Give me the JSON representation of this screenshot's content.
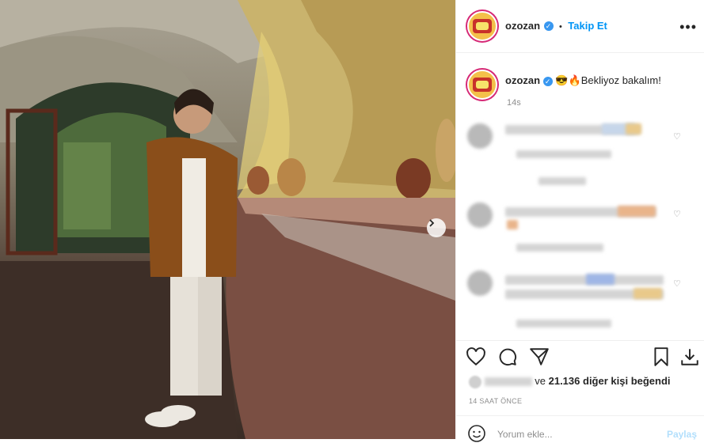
{
  "header": {
    "username": "ozozan",
    "separator": "•",
    "follow_label": "Takip Et",
    "more_label": "•••"
  },
  "caption": {
    "username": "ozozan",
    "emojis": "😎🔥",
    "text": "Bekliyoz bakalım!",
    "time": "14s"
  },
  "likes": {
    "suffix": "ve",
    "count": "21.136",
    "rest": "diğer kişi beğendi"
  },
  "timestamp": "14 SAAT ÖNCE",
  "add_comment": {
    "placeholder": "Yorum ekle...",
    "post_label": "Paylaş"
  },
  "icons": {
    "next": "chevron-right-icon",
    "like": "heart-icon",
    "comment": "comment-icon",
    "share": "send-icon",
    "save": "bookmark-icon",
    "download": "download-icon",
    "emoji": "smiley-icon"
  },
  "colors": {
    "accent": "#0095f6",
    "verified": "#3897f0",
    "text": "#262626",
    "muted": "#8e8e8e"
  }
}
